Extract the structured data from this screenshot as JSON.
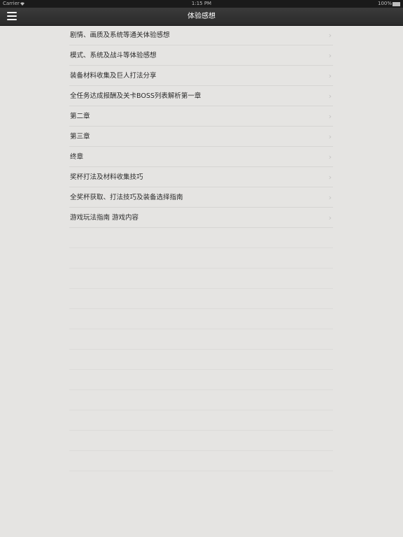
{
  "status_bar": {
    "carrier": "Carrier",
    "wifi_icon": "wifi-icon",
    "time": "1:15 PM",
    "battery": "100%"
  },
  "nav": {
    "title": "体验感想",
    "menu_icon": "hamburger-menu-icon"
  },
  "list": {
    "items": [
      {
        "label": "剧情、画质及系统等通关体验感想"
      },
      {
        "label": "模式、系统及战斗等体验感想"
      },
      {
        "label": "装备材料收集及巨人打法分享"
      },
      {
        "label": "全任务达成报酬及关卡BOSS列表解析第一章"
      },
      {
        "label": "第二章"
      },
      {
        "label": "第三章"
      },
      {
        "label": "终章"
      },
      {
        "label": "奖杯打法及材料收集技巧"
      },
      {
        "label": "全奖杯获取、打法技巧及装备选择指南"
      },
      {
        "label": "游戏玩法指南 游戏内容"
      }
    ],
    "chevron_glyph": "›"
  },
  "colors": {
    "background": "#e5e4e2",
    "nav_bar": "#2f2f2f",
    "text": "#2a2a2a",
    "separator": "#d6d5d3"
  }
}
